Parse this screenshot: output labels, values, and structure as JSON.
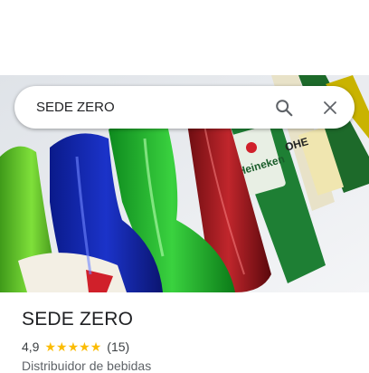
{
  "search": {
    "value": "SEDE ZERO",
    "search_icon": "search-icon",
    "close_icon": "close-icon"
  },
  "photo": {
    "description_icon": "place-photo",
    "bottle_label_1": "Heineken",
    "bottle_label_2": "OHE"
  },
  "place": {
    "name": "SEDE ZERO",
    "rating": "4,9",
    "stars": 5,
    "review_count": "(15)",
    "category": "Distribuidor de bebidas"
  },
  "colors": {
    "star": "#fbbc04",
    "title": "#202124",
    "text": "#3c4043"
  }
}
